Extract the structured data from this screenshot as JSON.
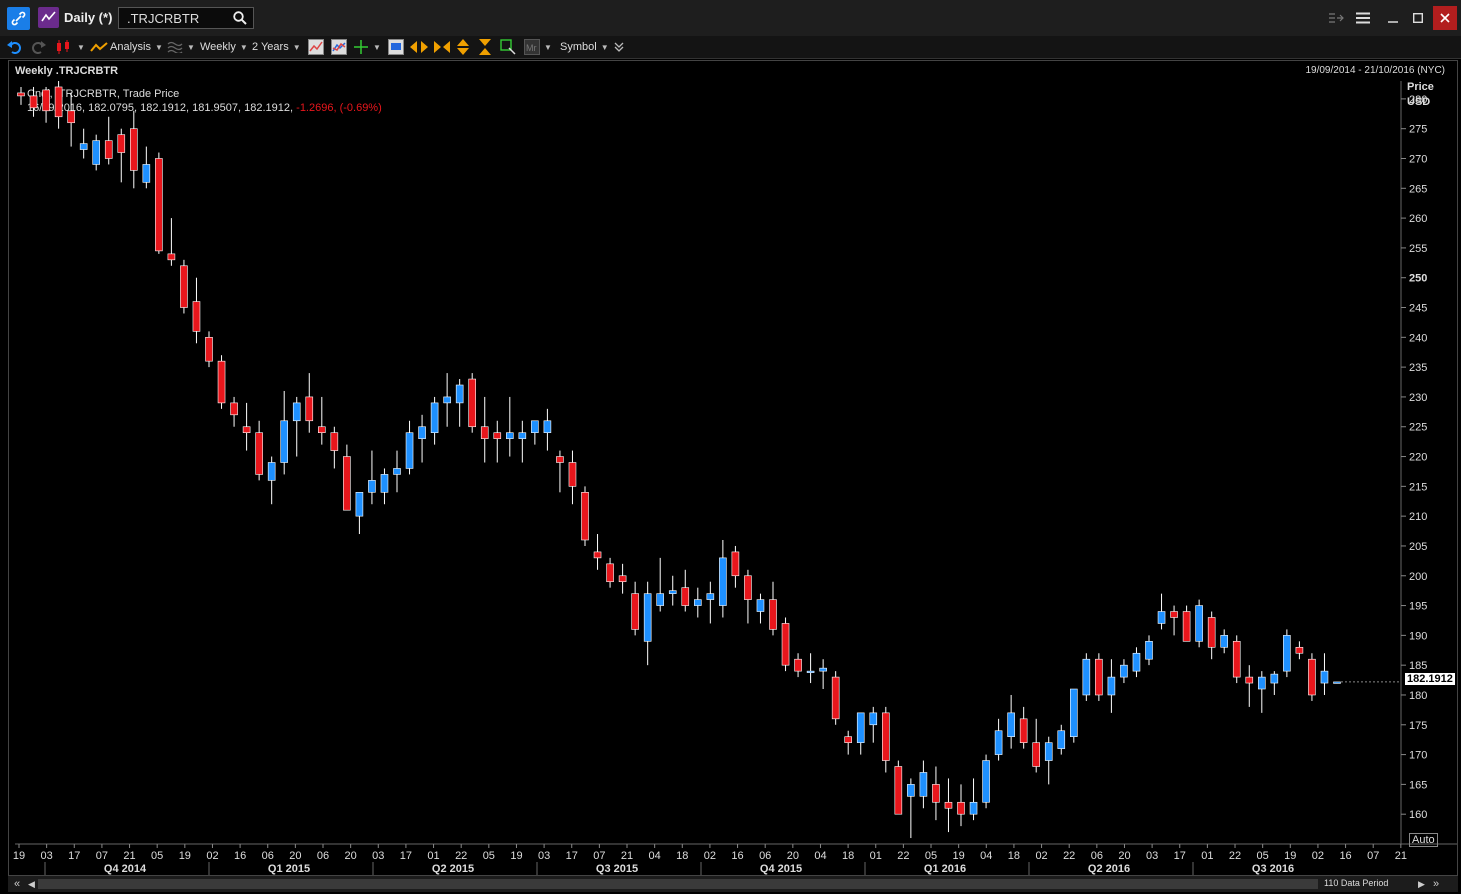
{
  "window": {
    "title": "Daily (*)",
    "ric_value": ".TRJCRBTR"
  },
  "toolbar": {
    "analysis_label": "Analysis",
    "interval_label": "Weekly",
    "range_label": "2 Years",
    "symbol_label": "Symbol"
  },
  "chart": {
    "title": "Weekly .TRJCRBTR",
    "date_range": "19/09/2014 - 21/10/2016 (NYC)",
    "legend_line1": "Cndl, .TRJCRBTR, Trade Price",
    "legend_values": "16/09/2016, 182.0795, 182.1912, 181.9507, 182.1912,",
    "legend_change": "-1.2696, (-0.69%)",
    "axis_title": "Price",
    "axis_unit": "USD",
    "last_price": "182.1912",
    "auto_label": "Auto",
    "data_period": "110 Data Period"
  },
  "colors": {
    "up": "#1e90ff",
    "down": "#e8161c",
    "background": "#000000",
    "change_negative": "#e8161c"
  },
  "chart_data": {
    "type": "candlestick",
    "ylim": [
      155,
      283
    ],
    "y_ticks": [
      160,
      165,
      170,
      175,
      180,
      185,
      190,
      195,
      200,
      205,
      210,
      215,
      220,
      225,
      230,
      235,
      240,
      245,
      250,
      255,
      260,
      265,
      270,
      275,
      280
    ],
    "x_ticks": [
      "19",
      "03",
      "17",
      "07",
      "21",
      "05",
      "19",
      "02",
      "16",
      "06",
      "20",
      "06",
      "20",
      "03",
      "17",
      "01",
      "22",
      "05",
      "19",
      "03",
      "17",
      "07",
      "21",
      "04",
      "18",
      "02",
      "16",
      "06",
      "20",
      "04",
      "18",
      "01",
      "22",
      "05",
      "19",
      "04",
      "18",
      "02",
      "22",
      "06",
      "20",
      "03",
      "17",
      "01",
      "22",
      "05",
      "19",
      "02",
      "16",
      "07",
      "21"
    ],
    "quarters": [
      "Q4 2014",
      "Q1 2015",
      "Q2 2015",
      "Q3 2015",
      "Q4 2015",
      "Q1 2016",
      "Q2 2016",
      "Q3 2016"
    ],
    "candles": [
      [
        281,
        282,
        279,
        280.5
      ],
      [
        280.5,
        282,
        277,
        278.5
      ],
      [
        281.5,
        282,
        276,
        278
      ],
      [
        282,
        283,
        275,
        277
      ],
      [
        278,
        281,
        272,
        276
      ],
      [
        271.5,
        275,
        270,
        272.5
      ],
      [
        269,
        274,
        268,
        273
      ],
      [
        273,
        277,
        269,
        270
      ],
      [
        274,
        275,
        266,
        271
      ],
      [
        275,
        278,
        265,
        268
      ],
      [
        266,
        272,
        265,
        269
      ],
      [
        270,
        271,
        254,
        254.5
      ],
      [
        254,
        260,
        252,
        253
      ],
      [
        252,
        253,
        244,
        245
      ],
      [
        246,
        250,
        239,
        241
      ],
      [
        240,
        241,
        235,
        236
      ],
      [
        236,
        237,
        228,
        229
      ],
      [
        229,
        230,
        225,
        227
      ],
      [
        225,
        229,
        221,
        224
      ],
      [
        224,
        226,
        216,
        217
      ],
      [
        216,
        220,
        212,
        219
      ],
      [
        219,
        231,
        217,
        226
      ],
      [
        226,
        230,
        220,
        229
      ],
      [
        230,
        234,
        224,
        226
      ],
      [
        225,
        230,
        222,
        224
      ],
      [
        224,
        225,
        218,
        221
      ],
      [
        220,
        222,
        211,
        211
      ],
      [
        210,
        214,
        207,
        214
      ],
      [
        214,
        221,
        212,
        216
      ],
      [
        214,
        218,
        212,
        217
      ],
      [
        217,
        221,
        214,
        218
      ],
      [
        218,
        226,
        217,
        224
      ],
      [
        223,
        227,
        219,
        225
      ],
      [
        224,
        230,
        222,
        229
      ],
      [
        229,
        234,
        225,
        230
      ],
      [
        229,
        233,
        225,
        232
      ],
      [
        233,
        234,
        224,
        225
      ],
      [
        225,
        230,
        219,
        223
      ],
      [
        224,
        226,
        219,
        223
      ],
      [
        223,
        230,
        220,
        224
      ],
      [
        223,
        226,
        219,
        224
      ],
      [
        224,
        226,
        222,
        226
      ],
      [
        224,
        228,
        221,
        226
      ],
      [
        220,
        221,
        214,
        219
      ],
      [
        219,
        221,
        212,
        215
      ],
      [
        214,
        215,
        205,
        206
      ],
      [
        204,
        207,
        201,
        203
      ],
      [
        202,
        203,
        198,
        199
      ],
      [
        200,
        202,
        197,
        199
      ],
      [
        197,
        199,
        190,
        191
      ],
      [
        189,
        199,
        185,
        197
      ],
      [
        195,
        203,
        194,
        197
      ],
      [
        197,
        200,
        195,
        197.5
      ],
      [
        198,
        201,
        194,
        195
      ],
      [
        195,
        198,
        193,
        196
      ],
      [
        196,
        199,
        192,
        197
      ],
      [
        195,
        206,
        193,
        203
      ],
      [
        204,
        205,
        198,
        200
      ],
      [
        200,
        201,
        192,
        196
      ],
      [
        194,
        197,
        192,
        196
      ],
      [
        196,
        199,
        190,
        191
      ],
      [
        192,
        193,
        184,
        185
      ],
      [
        186,
        187,
        183,
        184
      ],
      [
        184,
        187,
        182,
        184
      ],
      [
        184,
        186,
        181,
        184.5
      ],
      [
        183,
        184,
        175,
        176
      ],
      [
        173,
        174,
        170,
        172
      ],
      [
        172,
        177,
        170,
        177
      ],
      [
        175,
        178,
        172,
        177
      ],
      [
        177,
        178,
        167,
        169
      ],
      [
        168,
        169,
        160,
        160
      ],
      [
        163,
        166,
        156,
        165
      ],
      [
        163,
        169,
        161,
        167
      ],
      [
        165,
        168,
        159,
        162
      ],
      [
        162,
        166,
        157,
        161
      ],
      [
        162,
        165,
        158,
        160
      ],
      [
        160,
        166,
        159,
        162
      ],
      [
        162,
        170,
        161,
        169
      ],
      [
        170,
        176,
        169,
        174
      ],
      [
        173,
        180,
        171,
        177
      ],
      [
        176,
        178,
        171,
        172
      ],
      [
        172,
        176,
        167,
        168
      ],
      [
        169,
        173,
        165,
        172
      ],
      [
        171,
        175,
        170,
        174
      ],
      [
        173,
        181,
        172,
        181
      ],
      [
        180,
        187,
        179,
        186
      ],
      [
        186,
        187,
        179,
        180
      ],
      [
        180,
        186,
        177,
        183
      ],
      [
        183,
        186,
        182,
        185
      ],
      [
        184,
        188,
        183,
        187
      ],
      [
        186,
        190,
        185,
        189
      ],
      [
        192,
        197,
        191,
        194
      ],
      [
        194,
        195,
        190,
        193
      ],
      [
        194,
        195,
        189,
        189
      ],
      [
        189,
        196,
        188,
        195
      ],
      [
        193,
        194,
        186,
        188
      ],
      [
        188,
        191,
        187,
        190
      ],
      [
        189,
        190,
        182,
        183
      ],
      [
        183,
        185,
        178,
        182
      ],
      [
        181,
        184,
        177,
        183
      ],
      [
        182,
        184,
        180,
        183.5
      ],
      [
        184,
        191,
        183,
        190
      ],
      [
        188,
        189,
        186,
        187
      ],
      [
        186,
        187,
        179,
        180
      ],
      [
        182,
        187,
        180,
        184
      ],
      [
        182.0795,
        182.1912,
        181.9507,
        182.1912
      ]
    ]
  }
}
